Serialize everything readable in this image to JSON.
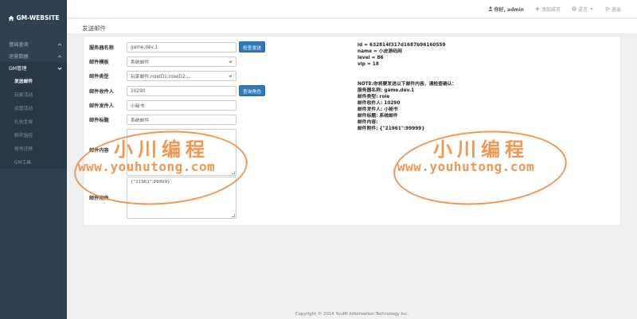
{
  "brand": {
    "name": "GM-WEBSITE"
  },
  "sidebar": {
    "sections": [
      {
        "label": "基础查询"
      },
      {
        "label": "运营数据"
      },
      {
        "label": "GM管理"
      }
    ],
    "gm_items": [
      {
        "label": "发送邮件"
      },
      {
        "label": "玩家活动"
      },
      {
        "label": "运营活动"
      },
      {
        "label": "礼包生成"
      },
      {
        "label": "聊天监控"
      },
      {
        "label": "账号迁移"
      },
      {
        "label": "GM工具"
      }
    ]
  },
  "topbar": {
    "greeting": "你好, admin",
    "add_button": "添加成员",
    "language": "语言",
    "logout": "退出"
  },
  "page": {
    "title": "发送邮件"
  },
  "form": {
    "server_label": "服务器名称",
    "server_value": "game.dev.1",
    "check_button": "检查发送",
    "template_label": "邮件模板",
    "template_value": "系统邮件",
    "type_label": "邮件类型",
    "type_value": "玩家邮件,roleID1;roleID2;...",
    "receiver_label": "邮件收件人",
    "receiver_value": "10290",
    "query_button": "查询角色",
    "sender_label": "邮件发件人",
    "sender_value": "小秘书",
    "subject_label": "邮件标题",
    "subject_value": "系统邮件",
    "content_label": "邮件内容",
    "content_value": "",
    "attachment_label": "邮件附件",
    "attachment_value": "{\"21961\":99999}"
  },
  "player_info": {
    "id": "id = 632814f317d1687b96160559",
    "name": "name = 小皮游码网",
    "level": "level = 86",
    "vip": "vip = 18"
  },
  "confirm_info": {
    "notice": "NOTE:你将要发送以下邮件内容，请检查确认：",
    "server": "服务器名称: game.dev.1",
    "type": "邮件类型: role",
    "receiver": "邮件收件人: 10290",
    "sender": "邮件发件人: 小秘书",
    "subject": "邮件标题: 系统邮件",
    "content": "邮件内容:",
    "attachment": "邮件附件: {\"21961\":99999}"
  },
  "watermark": {
    "title": "小川编程",
    "url": "www.youhutong.com"
  },
  "footer": {
    "text": "Copyright © 2014 YouMi Information Technology Inc."
  },
  "colors": {
    "sidebar": "#2f4050",
    "primary_button": "#3078b7",
    "watermark": "#f08c3e"
  }
}
